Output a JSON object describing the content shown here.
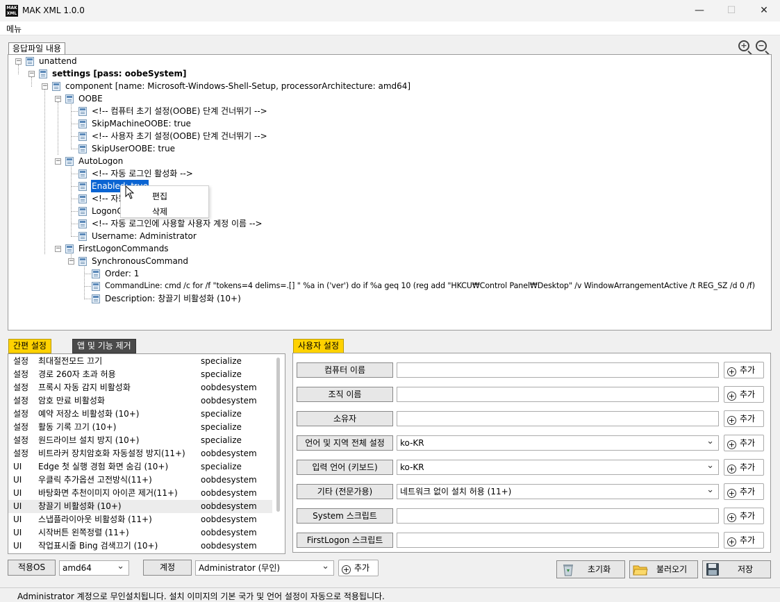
{
  "window": {
    "title": "MAK XML 1.0.0",
    "logo_text": "MAK XML",
    "minimize": "—",
    "maximize": "☐",
    "close": "✕"
  },
  "menu": {
    "label": "메뉴"
  },
  "response_panel": {
    "label": "응답파일 내용",
    "tree": [
      {
        "text": "unattend",
        "bold": false
      },
      {
        "text": "settings [pass: oobeSystem]",
        "bold": true
      },
      {
        "text": "component [name: Microsoft-Windows-Shell-Setup, processorArchitecture: amd64]",
        "bold": false
      },
      {
        "text": "OOBE",
        "bold": false
      },
      {
        "text": "<!-- 컴퓨터 초기 설정(OOBE) 단계 건너뛰기 -->",
        "bold": false
      },
      {
        "text": "SkipMachineOOBE: true",
        "bold": false
      },
      {
        "text": "<!-- 사용자 초기 설정(OOBE) 단계 건너뛰기 -->",
        "bold": false
      },
      {
        "text": "SkipUserOOBE: true",
        "bold": false
      },
      {
        "text": "AutoLogon",
        "bold": false
      },
      {
        "text": "<!-- 자동 로그인 활성화 -->",
        "bold": false
      },
      {
        "text": "Enabled: true",
        "bold": false,
        "selected": true
      },
      {
        "text": "<!-- 자동",
        "bold": false
      },
      {
        "text": "LogonCo",
        "bold": false
      },
      {
        "text": "<!-- 자동 로그인에 사용할 사용자 계정 이름 -->",
        "bold": false
      },
      {
        "text": "Username: Administrator",
        "bold": false
      },
      {
        "text": "FirstLogonCommands",
        "bold": false
      },
      {
        "text": "SynchronousCommand",
        "bold": false
      },
      {
        "text": "Order: 1",
        "bold": false
      },
      {
        "text": "CommandLine: cmd /c for /f \"tokens=4 delims=.[] \" %a in ('ver') do if %a geq 10 (reg add \"HKCU₩Control Panel₩Desktop\" /v WindowArrangementActive /t REG_SZ /d 0 /f)",
        "bold": false
      },
      {
        "text": "Description: 창끌기 비활성화 (10+)",
        "bold": false
      }
    ],
    "context_menu": {
      "edit": "편집",
      "delete": "삭제"
    }
  },
  "tabs": {
    "simple": "간편 설정",
    "apps": "앱 및 기능 제거",
    "user": "사용자 설정"
  },
  "settings_list": [
    {
      "type": "설정",
      "name": "최대절전모드 끄기",
      "pass": "specialize"
    },
    {
      "type": "설정",
      "name": "경로 260자 초과 허용",
      "pass": "specialize"
    },
    {
      "type": "설정",
      "name": "프록시 자동 감지 비활성화",
      "pass": "oobdesystem"
    },
    {
      "type": "설정",
      "name": "암호 만료 비활성화",
      "pass": "oobdesystem"
    },
    {
      "type": "설정",
      "name": "예약 저장소 비활성화 (10+)",
      "pass": "specialize"
    },
    {
      "type": "설정",
      "name": "활동 기록 끄기 (10+)",
      "pass": "specialize"
    },
    {
      "type": "설정",
      "name": "원드라이브 설치 방지 (10+)",
      "pass": "specialize"
    },
    {
      "type": "설정",
      "name": "비트라커 장치암호화 자동설정 방지(11+)",
      "pass": "oobdesystem"
    },
    {
      "type": "UI",
      "name": "Edge 첫 실행 경험 화면 숨김 (10+)",
      "pass": "specialize"
    },
    {
      "type": "UI",
      "name": "우클릭 추가옵션 고전방식(11+)",
      "pass": "oobdesystem"
    },
    {
      "type": "UI",
      "name": "바탕화면 추천이미지 아이콘 제거(11+)",
      "pass": "oobdesystem"
    },
    {
      "type": "UI",
      "name": "창끌기 비활성화 (10+)",
      "pass": "oobdesystem"
    },
    {
      "type": "UI",
      "name": "스냅플라이아웃 비활성화 (11+)",
      "pass": "oobdesystem"
    },
    {
      "type": "UI",
      "name": "시작버튼 왼쪽정렬 (11+)",
      "pass": "oobdesystem"
    },
    {
      "type": "UI",
      "name": "작업표시줄 Bing 검색끄기 (10+)",
      "pass": "oobdesystem"
    }
  ],
  "user_fields": [
    {
      "label": "컴퓨터 이름",
      "value": "",
      "combo": false
    },
    {
      "label": "조직 이름",
      "value": "",
      "combo": false
    },
    {
      "label": "소유자",
      "value": "",
      "combo": false
    },
    {
      "label": "언어 및 지역 전체 설정",
      "value": "ko-KR",
      "combo": true
    },
    {
      "label": "입력 언어 (키보드)",
      "value": "ko-KR",
      "combo": true
    },
    {
      "label": "기타 (전문가용)",
      "value": "네트워크 없이 설치 허용 (11+)",
      "combo": true
    },
    {
      "label": "System 스크립트",
      "value": "",
      "combo": false
    },
    {
      "label": "FirstLogon 스크립트",
      "value": "",
      "combo": false
    }
  ],
  "add_label": "추가",
  "bottom": {
    "os_label": "적용OS",
    "os_value": "amd64",
    "account_label": "계정",
    "account_value": "Administrator (무인)",
    "add_label": "추가",
    "reset": "초기화",
    "load": "불러오기",
    "save": "저장"
  },
  "status": "Administrator 계정으로 무인설치됩니다. 설치 이미지의 기본 국가 및 언어 설정이 자동으로 적용됩니다."
}
